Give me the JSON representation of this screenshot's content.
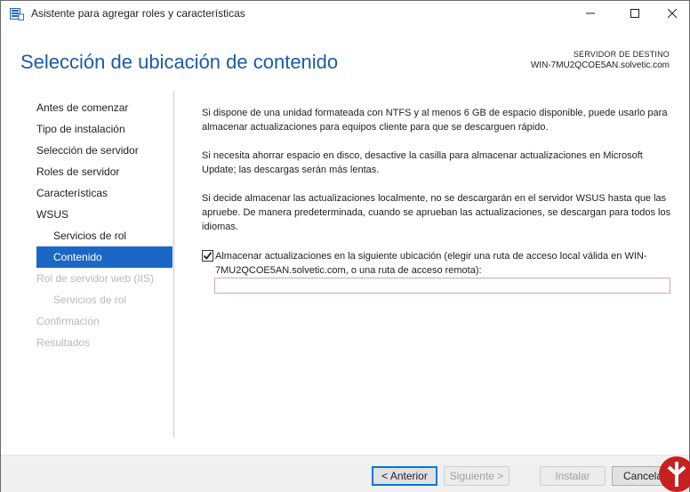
{
  "window": {
    "title": "Asistente para agregar roles y características",
    "app_icon": "server-manager-icon"
  },
  "header": {
    "heading": "Selección de ubicación de contenido",
    "dest_label": "SERVIDOR DE DESTINO",
    "dest_server": "WIN-7MU2QCOE5AN.solvetic.com"
  },
  "nav": {
    "items": [
      {
        "label": "Antes de comenzar",
        "state": "normal"
      },
      {
        "label": "Tipo de instalación",
        "state": "normal"
      },
      {
        "label": "Selección de servidor",
        "state": "normal"
      },
      {
        "label": "Roles de servidor",
        "state": "normal"
      },
      {
        "label": "Características",
        "state": "normal"
      },
      {
        "label": "WSUS",
        "state": "normal"
      },
      {
        "label": "Servicios de rol",
        "state": "normal"
      },
      {
        "label": "Contenido",
        "state": "selected"
      },
      {
        "label": "Rol de servidor web (IIS)",
        "state": "disabled"
      },
      {
        "label": "Servicios de rol",
        "state": "disabled"
      },
      {
        "label": "Confirmación",
        "state": "disabled"
      },
      {
        "label": "Resultados",
        "state": "disabled"
      }
    ]
  },
  "content": {
    "para1": "Si dispone de una unidad formateada con NTFS y al menos 6 GB de espacio disponible, puede usarlo para almacenar actualizaciones para equipos cliente para que se descarguen rápido.",
    "para2": "Si necesita ahorrar espacio en disco, desactive la casilla para almacenar actualizaciones en Microsoft Update; las descargas serán más lentas.",
    "para3": "Si decide almacenar las actualizaciones localmente, no se descargarán en el servidor WSUS hasta que las apruebe. De manera predeterminada, cuando se aprueban las actualizaciones, se descargan para todos los idiomas.",
    "checkbox_label": "Almacenar actualizaciones en la siguiente ubicación (elegir una ruta de acceso local válida en WIN-7MU2QCOE5AN.solvetic.com, o una ruta de acceso remota):",
    "checkbox_checked": true,
    "path_value": ""
  },
  "footer": {
    "back": "< Anterior",
    "next": "Siguiente >",
    "install": "Instalar",
    "cancel": "Cancelar"
  },
  "colors": {
    "heading": "#1e5aa0",
    "selected_nav": "#1b67c5",
    "disabled_text": "#b9b9b9"
  }
}
